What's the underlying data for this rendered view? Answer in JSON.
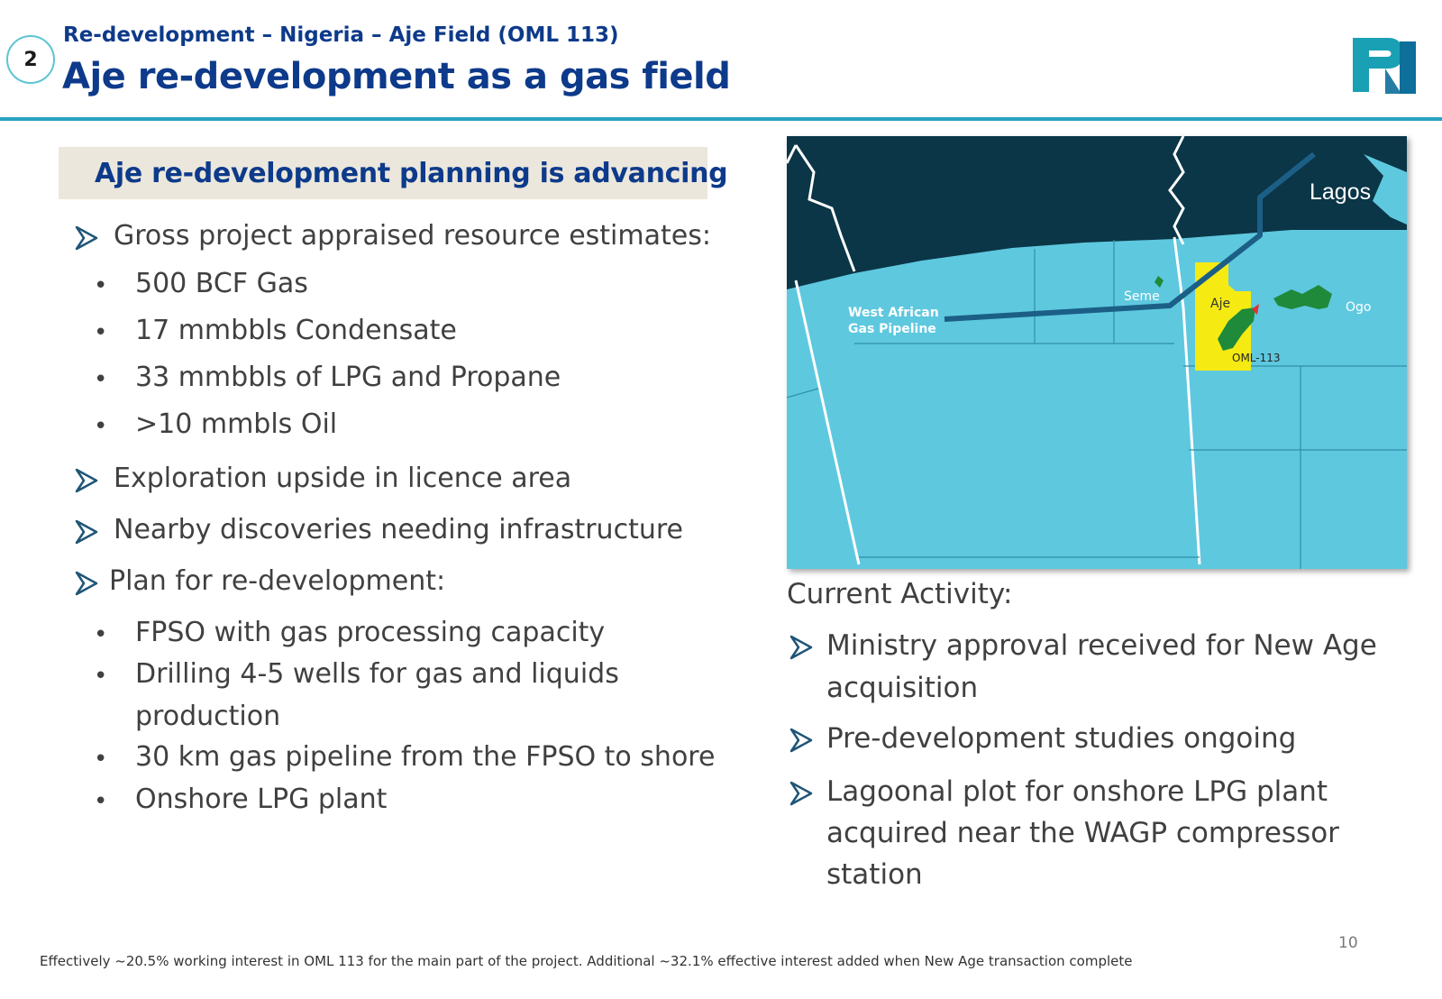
{
  "header": {
    "slide_number": "2",
    "subtitle": "Re-development – Nigeria – Aje Field (OML 113)",
    "title": "Aje re-development as a gas field"
  },
  "banner": {
    "text": "Aje re-development planning is advancing"
  },
  "left_list": {
    "gross": "Gross project appraised resource estimates:",
    "resources": [
      "500 BCF Gas",
      "17 mmbbls Condensate",
      "33 mmbbls of LPG and Propane",
      ">10 mmbls Oil"
    ],
    "exploration": "Exploration upside in licence area",
    "nearby": "Nearby discoveries needing infrastructure",
    "plan": "Plan for re-development:",
    "plan_items": [
      "FPSO with gas processing capacity",
      "Drilling 4-5 wells for gas and liquids",
      "production",
      "30 km gas pipeline from the FPSO to shore",
      "Onshore LPG plant"
    ]
  },
  "map": {
    "labels": {
      "lagos": "Lagos",
      "pipeline_line1": "West African",
      "pipeline_line2": "Gas Pipeline",
      "seme": "Seme",
      "aje": "Aje",
      "ogo": "Ogo",
      "oml": "OML-113"
    },
    "colors": {
      "land": "#0b3647",
      "sea": "#5ec8df",
      "block": "#f5eb12",
      "field": "#1f8a3a",
      "pipeline": "#1c5f86"
    }
  },
  "activity": {
    "title": "Current Activity:",
    "items": [
      "Ministry approval received for New Age",
      "acquisition",
      "Pre-development studies ongoing",
      "Lagoonal plot for onshore LPG plant",
      "acquired near the WAGP compressor",
      "station"
    ]
  },
  "footnote": "Effectively ~20.5% working interest in OML 113 for the main part of the project. Additional ~32.1% effective interest added when New Age transaction complete",
  "page_number": "10"
}
